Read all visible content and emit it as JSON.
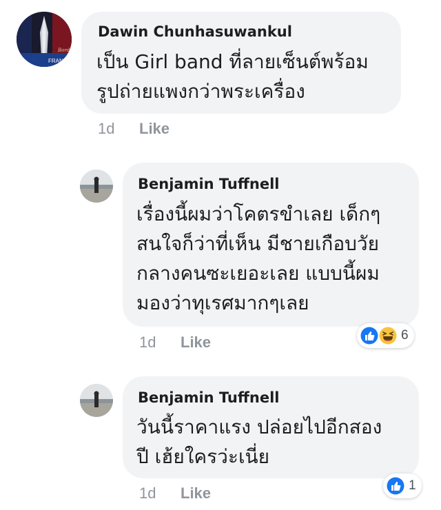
{
  "comments": [
    {
      "author": "Dawin Chunhasuwankul",
      "text": "เป็น Girl band ที่ลายเซ็นต์พร้อม\nรูปถ่ายแพงกว่าพระเครื่อง",
      "time": "1d",
      "like_label": "Like",
      "avatar_caption": "FRANC"
    },
    {
      "author": "Benjamin Tuffnell",
      "text": "เรื่องนี้ผมว่าโคตรขำเลย เด็กๆ\nสนใจก็ว่าที่เห็น มีชายเกือบวัย\nกลางคนซะเยอะเลย แบบนี้ผม\nมองว่าทุเรศมากๆเลย",
      "time": "1d",
      "like_label": "Like",
      "reactions": {
        "icons": [
          "like-icon",
          "haha-icon"
        ],
        "count": "6"
      }
    },
    {
      "author": "Benjamin Tuffnell",
      "text": "วันนี้ราคาแรง ปล่อยไปอีกสอง\nปี เฮ้ยใครว่ะเนี่ย",
      "time": "1d",
      "like_label": "Like",
      "reactions": {
        "icons": [
          "like-icon"
        ],
        "count": "1"
      }
    }
  ],
  "colors": {
    "bubble": "#f2f3f5",
    "meta_text": "#90949c",
    "like_blue": "#1877f2",
    "haha_yellow": "#f7c43d"
  }
}
